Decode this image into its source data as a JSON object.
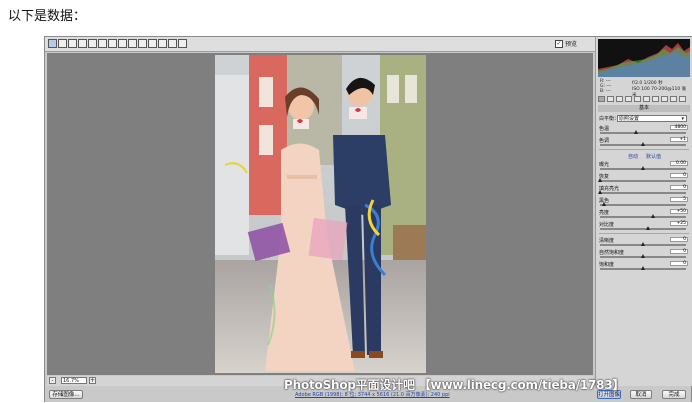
{
  "caption": "以下是数据：",
  "toolbar": {
    "tools": [
      "zoom-icon",
      "hand-icon",
      "eyedropper-icon",
      "color-sampler-icon",
      "target-adjust-icon",
      "crop-icon",
      "straighten-icon",
      "spot-removal-icon",
      "red-eye-icon",
      "adjustment-brush-icon",
      "graduated-filter-icon",
      "preferences-icon",
      "rotate-ccw-icon",
      "rotate-cw-icon"
    ],
    "preview_label": "预览",
    "preview_checked": true
  },
  "histogram": {
    "readout_left": [
      "R: ---",
      "G: ---",
      "B: ---"
    ],
    "readout_right_line1": "f/2.0  1/200 秒",
    "readout_right_line2": "ISO 100  70-200@110 毫米"
  },
  "panel": {
    "title": "基本",
    "white_balance_label": "白平衡：",
    "white_balance_value": "原照设置",
    "auto_link": "自动",
    "default_link": "默认值",
    "sliders": [
      {
        "label": "色温",
        "value": "4800",
        "pos": 0.42
      },
      {
        "label": "色调",
        "value": "+1",
        "pos": 0.5
      },
      {
        "label": "曝光",
        "value": "0.00",
        "pos": 0.5
      },
      {
        "label": "恢复",
        "value": "0",
        "pos": 0.0
      },
      {
        "label": "填充亮光",
        "value": "0",
        "pos": 0.0
      },
      {
        "label": "黑色",
        "value": "5",
        "pos": 0.05
      },
      {
        "label": "亮度",
        "value": "+50",
        "pos": 0.62
      },
      {
        "label": "对比度",
        "value": "+25",
        "pos": 0.56
      },
      {
        "label": "清晰度",
        "value": "0",
        "pos": 0.5
      },
      {
        "label": "自然饱和度",
        "value": "0",
        "pos": 0.5
      },
      {
        "label": "饱和度",
        "value": "0",
        "pos": 0.5
      }
    ]
  },
  "statusbar": {
    "zoom_value": "16.7%",
    "zoom_minus": "-",
    "zoom_plus": "+"
  },
  "bottom": {
    "save_button": "存储图像...",
    "info_link": "Adobe RGB (1998); 8 位; 3744 x 5616 (21.0 百万像素); 240 ppi",
    "open_button": "打开图像",
    "cancel_button": "取消",
    "done_button": "完成"
  },
  "watermark": "PhotoShop平面设计吧 【www.linecg.com/tieba/1783】",
  "colors": {
    "accent": "#3d67b3",
    "canvas": "#7f7f7f"
  }
}
